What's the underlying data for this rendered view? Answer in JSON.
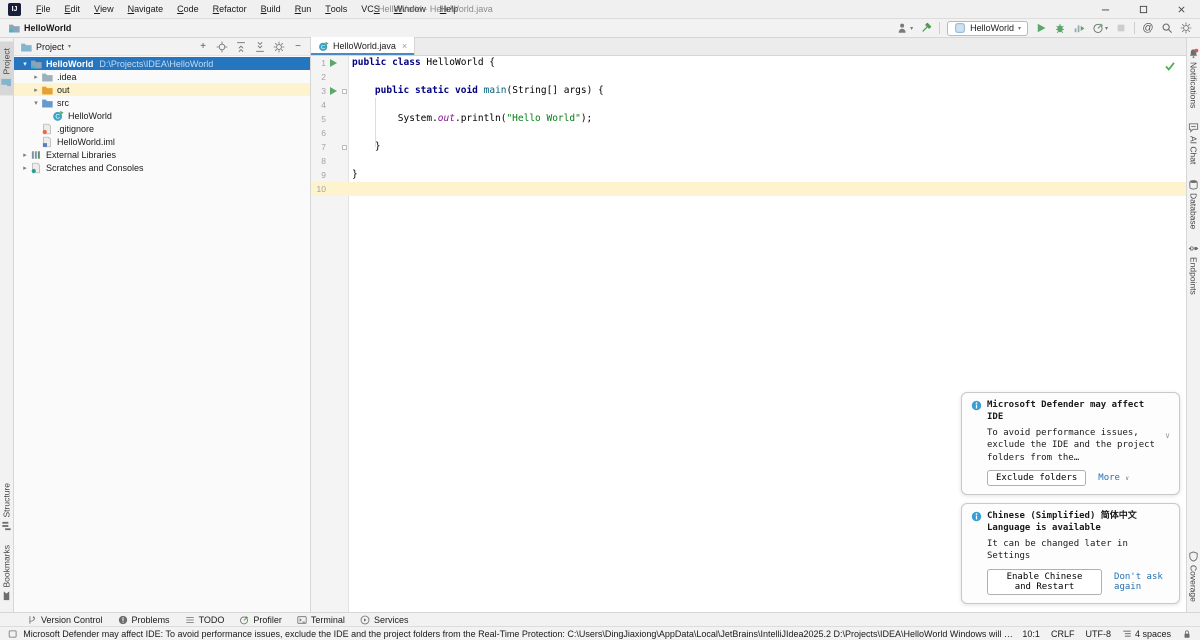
{
  "title_bar": {
    "menus": [
      {
        "label": "File",
        "mnemonic": 0
      },
      {
        "label": "Edit",
        "mnemonic": 0
      },
      {
        "label": "View",
        "mnemonic": 0
      },
      {
        "label": "Navigate",
        "mnemonic": 0
      },
      {
        "label": "Code",
        "mnemonic": 0
      },
      {
        "label": "Refactor",
        "mnemonic": 0
      },
      {
        "label": "Build",
        "mnemonic": 0
      },
      {
        "label": "Run",
        "mnemonic": 0
      },
      {
        "label": "Tools",
        "mnemonic": 0
      },
      {
        "label": "VCS",
        "mnemonic": 2
      },
      {
        "label": "Window",
        "mnemonic": 0
      },
      {
        "label": "Help",
        "mnemonic": 0
      }
    ],
    "window_title": "HelloWorld - HelloWorld.java",
    "window_controls": [
      "minimize",
      "maximize",
      "close"
    ]
  },
  "toolbar": {
    "project_name": "HelloWorld",
    "run_config": "HelloWorld",
    "actions": [
      {
        "kind": "icon",
        "icon": "user",
        "name": "user-profile",
        "dropdown": true
      },
      {
        "kind": "icon",
        "icon": "hammer",
        "name": "build-project"
      },
      {
        "kind": "sep"
      },
      {
        "kind": "combo",
        "icon": "app-config",
        "name": "run-configurations"
      },
      {
        "kind": "icon",
        "icon": "run",
        "name": "run"
      },
      {
        "kind": "icon",
        "icon": "debug",
        "name": "debug"
      },
      {
        "kind": "icon",
        "icon": "coverage",
        "name": "run-with-coverage"
      },
      {
        "kind": "icon",
        "icon": "profiler",
        "name": "profile",
        "dropdown": true
      },
      {
        "kind": "icon",
        "icon": "stop",
        "name": "stop",
        "disabled": true
      },
      {
        "kind": "sep"
      },
      {
        "kind": "icon",
        "icon": "at",
        "name": "mentions"
      },
      {
        "kind": "icon",
        "icon": "search",
        "name": "search-everywhere"
      },
      {
        "kind": "icon",
        "icon": "gear",
        "name": "settings"
      }
    ]
  },
  "left_stripe": {
    "top": [
      {
        "icon": "folder-panel",
        "label": "Project",
        "active": true
      }
    ],
    "bottom": [
      {
        "icon": "structure",
        "label": "Structure"
      },
      {
        "icon": "bookmarks",
        "label": "Bookmarks"
      }
    ]
  },
  "right_stripe": {
    "top": [
      {
        "icon": "notifications-bell",
        "label": "Notifications"
      },
      {
        "icon": "ai-chat",
        "label": "AI Chat"
      },
      {
        "icon": "database",
        "label": "Database"
      },
      {
        "icon": "endpoints",
        "label": "Endpoints"
      }
    ],
    "bottom": [
      {
        "icon": "coverage-shield",
        "label": "Coverage"
      }
    ]
  },
  "project_panel": {
    "header": "Project",
    "header_actions": [
      {
        "icon": "plus",
        "name": "add"
      },
      {
        "icon": "locate",
        "name": "select-opened-file"
      },
      {
        "icon": "expand-all",
        "name": "expand-all"
      },
      {
        "icon": "collapse-all",
        "name": "collapse-all"
      },
      {
        "icon": "gear",
        "name": "view-options"
      },
      {
        "icon": "minus",
        "name": "hide-panel"
      }
    ],
    "tree": [
      {
        "label": "HelloWorld",
        "path": "D:\\Projects\\IDEA\\HelloWorld",
        "depth": 0,
        "chevron": "down",
        "icon": "folder-project",
        "selected": true,
        "bold": true
      },
      {
        "label": ".idea",
        "depth": 1,
        "chevron": "right",
        "icon": "folder-idea"
      },
      {
        "label": "out",
        "depth": 1,
        "chevron": "right",
        "icon": "folder-out",
        "highlight": true
      },
      {
        "label": "src",
        "depth": 1,
        "chevron": "down",
        "icon": "folder-src"
      },
      {
        "label": "HelloWorld",
        "depth": 2,
        "icon": "class-run"
      },
      {
        "label": ".gitignore",
        "depth": 1,
        "icon": "gitignore-file"
      },
      {
        "label": "HelloWorld.iml",
        "depth": 1,
        "icon": "iml-file"
      },
      {
        "label": "External Libraries",
        "depth": 0,
        "chevron": "right",
        "icon": "libraries"
      },
      {
        "label": "Scratches and Consoles",
        "depth": 0,
        "chevron": "right",
        "icon": "scratches"
      }
    ]
  },
  "editor": {
    "tab": "HelloWorld.java",
    "lines": [
      {
        "n": 1,
        "run": true,
        "tokens": [
          [
            "public",
            "kw"
          ],
          [
            " ",
            ""
          ],
          [
            "class",
            "kw"
          ],
          [
            " HelloWorld {",
            ""
          ]
        ]
      },
      {
        "n": 2,
        "tokens": []
      },
      {
        "n": 3,
        "run": true,
        "fold": true,
        "tokens": [
          [
            "    ",
            ""
          ],
          [
            "public",
            "kw"
          ],
          [
            " ",
            ""
          ],
          [
            "static",
            "kw"
          ],
          [
            " ",
            ""
          ],
          [
            "void",
            "kw"
          ],
          [
            " ",
            ""
          ],
          [
            "main",
            "method"
          ],
          [
            "(String[] args) {",
            ""
          ]
        ]
      },
      {
        "n": 4,
        "tokens": []
      },
      {
        "n": 5,
        "tokens": [
          [
            "        System.",
            ""
          ],
          [
            "out",
            "field"
          ],
          [
            ".println(",
            ""
          ],
          [
            "\"Hello World\"",
            "str"
          ],
          [
            ");",
            ""
          ]
        ]
      },
      {
        "n": 6,
        "tokens": []
      },
      {
        "n": 7,
        "fold": true,
        "tokens": [
          [
            "    }",
            ""
          ]
        ]
      },
      {
        "n": 8,
        "tokens": []
      },
      {
        "n": 9,
        "tokens": [
          [
            "}",
            ""
          ]
        ]
      },
      {
        "n": 10,
        "caret": true,
        "tokens": []
      }
    ]
  },
  "notifications": [
    {
      "title": "Microsoft Defender may affect IDE",
      "body": "To avoid performance issues, exclude the IDE and the project folders from the…",
      "primary_button": "Exclude folders",
      "link": "More"
    },
    {
      "title": "Chinese (Simplified) 简体中文 Language is available",
      "body": "It can be changed later in Settings",
      "primary_button": "Enable Chinese and Restart",
      "link": "Don't ask again"
    }
  ],
  "bottom_bar": {
    "tools": [
      {
        "icon": "branch",
        "label": "Version Control"
      },
      {
        "icon": "problems",
        "label": "Problems"
      },
      {
        "icon": "todo",
        "label": "TODO"
      },
      {
        "icon": "profiler-small",
        "label": "Profiler"
      },
      {
        "icon": "terminal",
        "label": "Terminal"
      },
      {
        "icon": "services",
        "label": "Services"
      }
    ]
  },
  "status_bar": {
    "message": "Microsoft Defender may affect IDE: To avoid performance issues, exclude the IDE and the project folders from the Real-Time Protection: C:\\Users\\DingJiaxiong\\AppData\\Local\\JetBrains\\IntelliJIdea2025.2 D:\\Projects\\IDEA\\HelloWorld Windows will prom... (moments ago)",
    "right_items": [
      {
        "text": "10:1",
        "name": "caret-position"
      },
      {
        "text": "CRLF",
        "name": "line-separator"
      },
      {
        "text": "UTF-8",
        "name": "file-encoding"
      },
      {
        "icon": "indent",
        "text": "4 spaces",
        "name": "indent-style"
      },
      {
        "icon": "lock",
        "text": "",
        "name": "read-only-toggle"
      }
    ]
  },
  "colors": {
    "selection_blue": "#2675bf",
    "keyword": "#000080",
    "string_green": "#067d17",
    "field_purple": "#871094",
    "run_green": "#59a869",
    "link_blue": "#2470b3",
    "caret_line": "#fdf3ce"
  }
}
